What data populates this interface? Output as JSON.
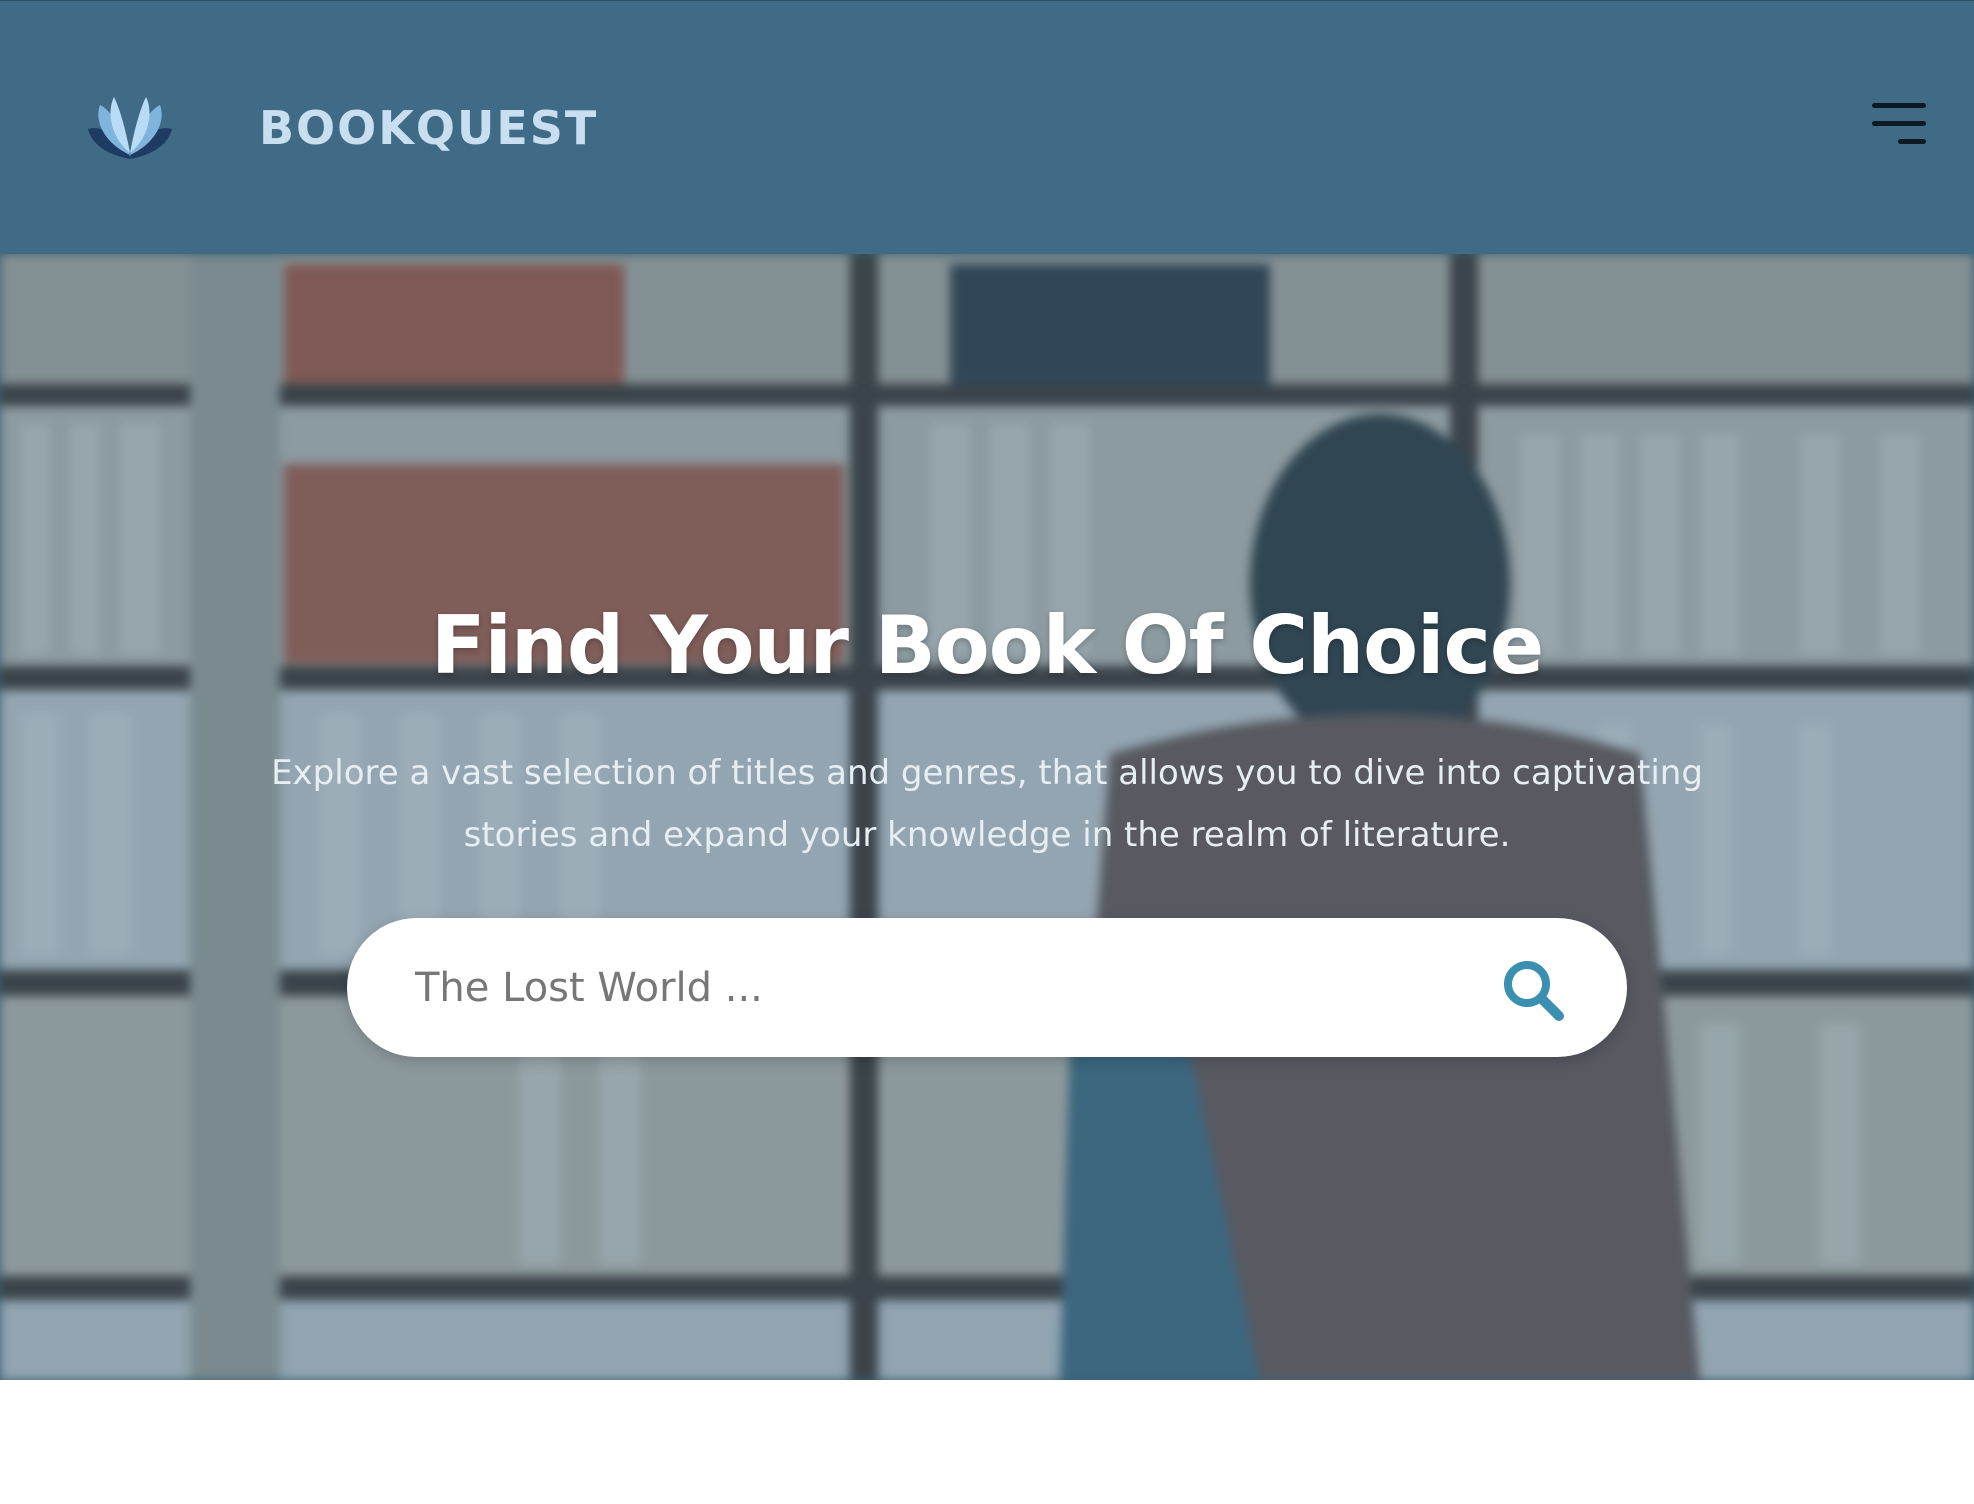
{
  "header": {
    "brand": "BOOKQUEST",
    "logo_icon": "open-book-icon",
    "menu_icon": "hamburger-menu-icon"
  },
  "hero": {
    "title": "Find Your Book Of Choice",
    "subtitle": "Explore a vast selection of titles and genres, that allows you to dive into captivating stories and expand your knowledge in the realm of literature.",
    "background": "blurred-bookshelf-photo",
    "search": {
      "value": "",
      "placeholder": "The Lost World ...",
      "icon": "search-icon"
    }
  },
  "colors": {
    "header_bg": "#3f6b87",
    "brand_text": "#c9dff0",
    "accent": "#3b8fb0",
    "overlay": "#3a627a",
    "page_bg": "#ffffff"
  }
}
